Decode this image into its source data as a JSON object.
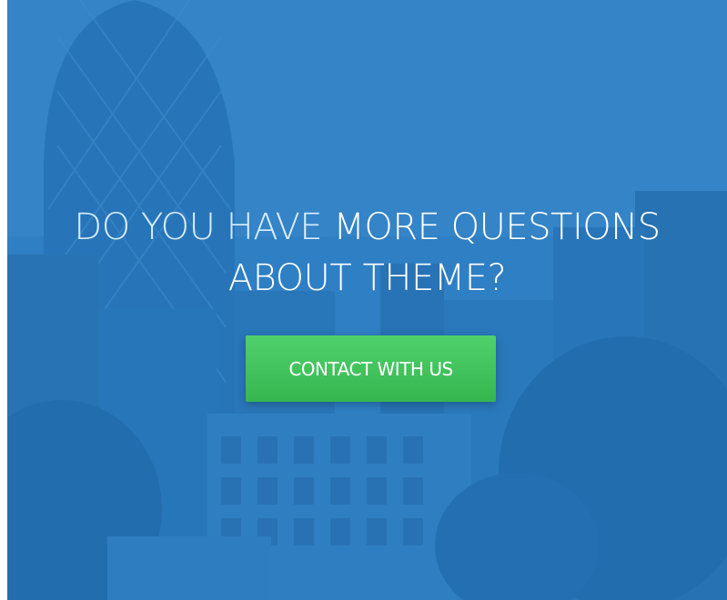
{
  "hero": {
    "headline_light": "DO YOU HAVE",
    "headline_rest": " MORE QUESTIONS",
    "headline_line2": "ABOUT THEME?",
    "cta_label": "CONTACT WITH US",
    "overlay_color": "#2f7fbf",
    "button_color": "#45c45e"
  }
}
